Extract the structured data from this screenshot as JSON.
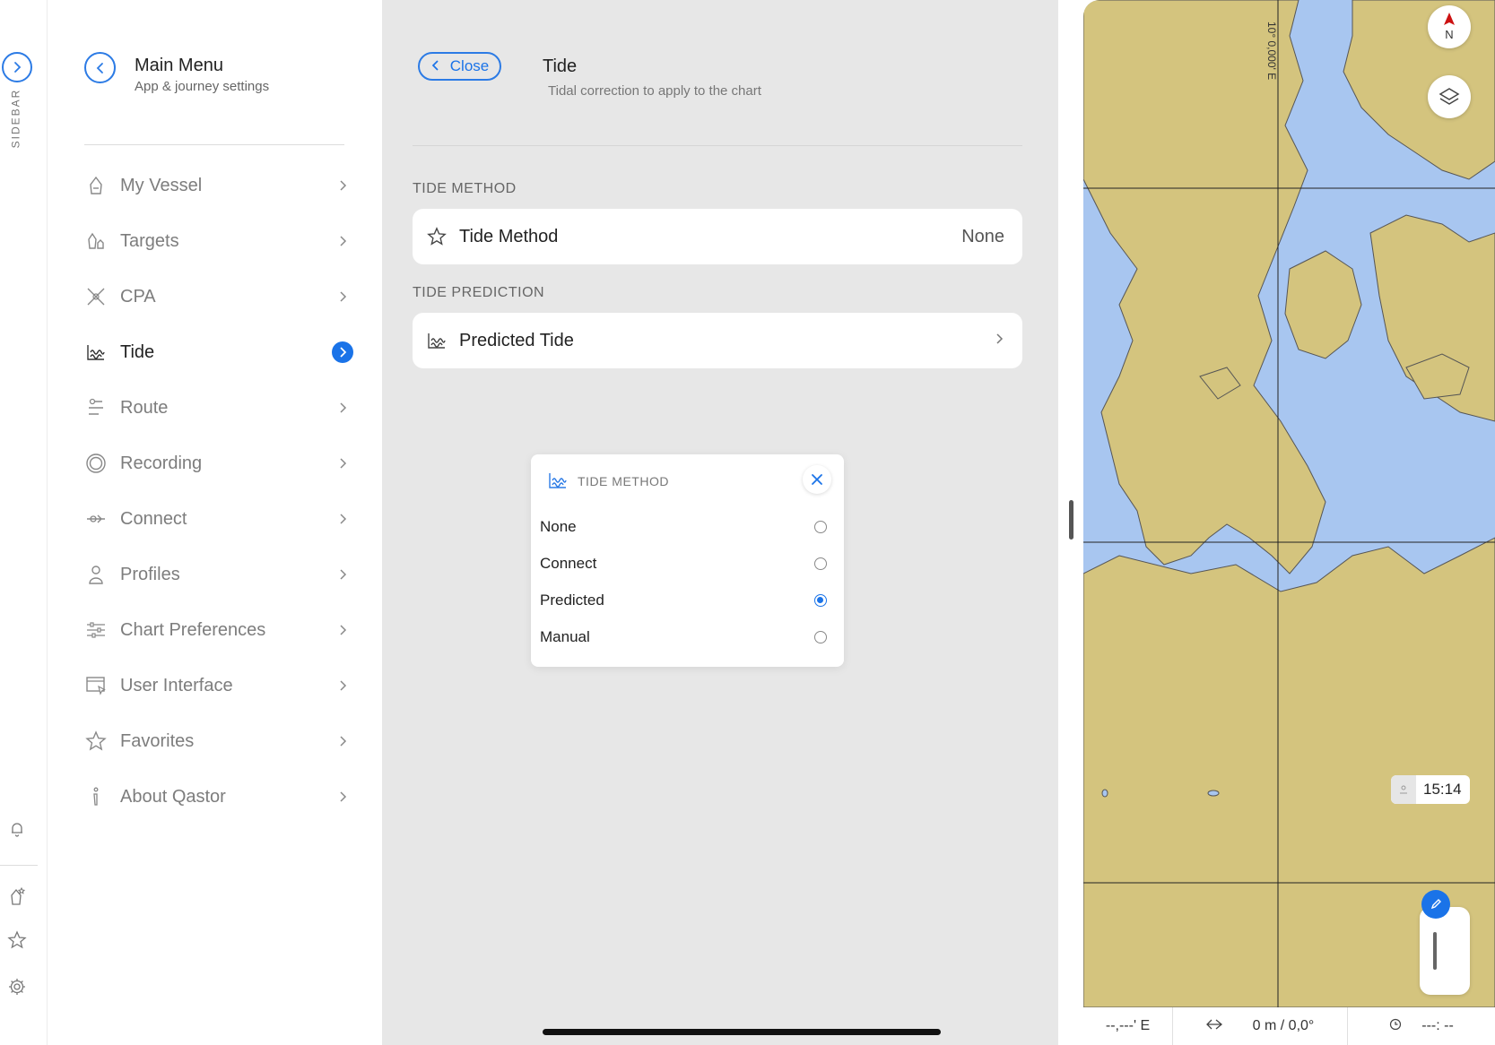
{
  "rail": {
    "label": "SIDEBAR",
    "icons": [
      "chevron-right-icon",
      "bell-icon",
      "vessel-star-icon",
      "star-icon",
      "gear-icon"
    ]
  },
  "menu": {
    "title": "Main Menu",
    "subtitle": "App & journey settings",
    "items": [
      {
        "label": "My Vessel",
        "icon": "vessel-icon"
      },
      {
        "label": "Targets",
        "icon": "targets-icon"
      },
      {
        "label": "CPA",
        "icon": "cpa-icon"
      },
      {
        "label": "Tide",
        "icon": "tide-icon",
        "active": true
      },
      {
        "label": "Route",
        "icon": "route-icon"
      },
      {
        "label": "Recording",
        "icon": "recording-icon"
      },
      {
        "label": "Connect",
        "icon": "connect-icon"
      },
      {
        "label": "Profiles",
        "icon": "profile-icon"
      },
      {
        "label": "Chart Preferences",
        "icon": "sliders-icon"
      },
      {
        "label": "User Interface",
        "icon": "ui-icon"
      },
      {
        "label": "Favorites",
        "icon": "star-icon"
      },
      {
        "label": "About Qastor",
        "icon": "info-icon"
      }
    ]
  },
  "panel": {
    "close_label": "Close",
    "title": "Tide",
    "subtitle": "Tidal correction to apply to the chart",
    "section1": "TIDE METHOD",
    "method_label": "Tide Method",
    "method_value": "None",
    "section2": "TIDE PREDICTION",
    "predicted_label": "Predicted Tide"
  },
  "popup": {
    "title": "TIDE METHOD",
    "options": [
      "None",
      "Connect",
      "Predicted",
      "Manual"
    ],
    "selected": "Predicted"
  },
  "map": {
    "compass_label": "N",
    "longitude_label": "10° 0,000' E",
    "time": "15:14",
    "status": {
      "position": "--,---' E",
      "speed_course": "0 m / 0,0°",
      "eta": "---: --"
    },
    "colors": {
      "water": "#a8c6f0",
      "land": "#d4c47e",
      "accent": "#1a73e8"
    }
  }
}
